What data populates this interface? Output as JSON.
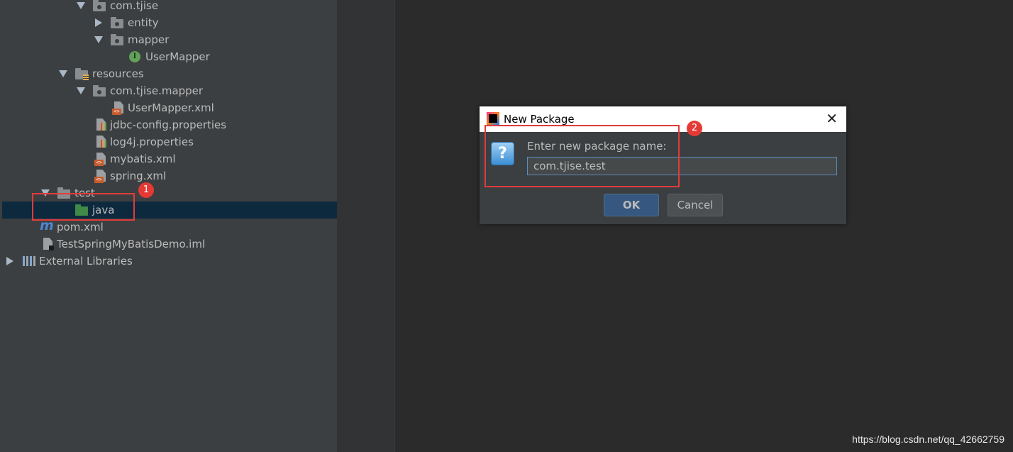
{
  "tree": {
    "items": [
      {
        "label": "com.tjise"
      },
      {
        "label": "entity"
      },
      {
        "label": "mapper"
      },
      {
        "label": "UserMapper"
      },
      {
        "label": "resources"
      },
      {
        "label": "com.tjise.mapper"
      },
      {
        "label": "UserMapper.xml"
      },
      {
        "label": "jdbc-config.properties"
      },
      {
        "label": "log4j.properties"
      },
      {
        "label": "mybatis.xml"
      },
      {
        "label": "spring.xml"
      },
      {
        "label": "test"
      },
      {
        "label": "java"
      },
      {
        "label": "pom.xml"
      },
      {
        "label": "TestSpringMyBatisDemo.iml"
      },
      {
        "label": "External Libraries"
      }
    ],
    "selected": "java"
  },
  "icons": {
    "interface": "I",
    "maven": "m",
    "xml": "<>"
  },
  "annotations": {
    "badge1": "1",
    "badge2": "2",
    "color": "#e53935"
  },
  "dialog": {
    "title": "New Package",
    "close_symbol": "✕",
    "question_icon": "?",
    "prompt": "Enter new package name:",
    "input_value": "com.tjise.test",
    "ok_label": "OK",
    "cancel_label": "Cancel"
  },
  "watermark": "https://blog.csdn.net/qq_42662759"
}
